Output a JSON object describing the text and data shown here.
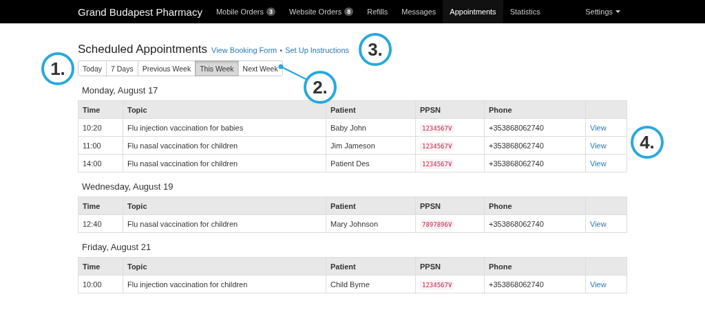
{
  "navbar": {
    "brand": "Grand Budapest Pharmacy",
    "items": [
      {
        "label": "Mobile Orders",
        "badge": "3",
        "selected": false
      },
      {
        "label": "Website Orders",
        "badge": "8",
        "selected": false
      },
      {
        "label": "Refills",
        "selected": false
      },
      {
        "label": "Messages",
        "selected": false
      },
      {
        "label": "Appointments",
        "selected": true
      },
      {
        "label": "Statistics",
        "selected": false
      }
    ],
    "settings": "Settings"
  },
  "title": "Scheduled Appointments",
  "links": [
    "View Booking Form",
    "Set Up Instructions"
  ],
  "separator": "•",
  "filters": [
    {
      "label": "Today",
      "selected": false
    },
    {
      "label": "7 Days",
      "selected": false
    },
    {
      "label": "Previous Week",
      "selected": false
    },
    {
      "label": "This Week",
      "selected": true
    },
    {
      "label": "Next Week",
      "selected": false
    }
  ],
  "days": [
    {
      "heading": "Monday, August 17",
      "columns": [
        "Time",
        "Topic",
        "Patient",
        "PPSN",
        "Phone"
      ],
      "rows": [
        {
          "time": "10:20",
          "topic": "Flu injection vaccination for babies",
          "patient": "Baby John",
          "ppsn": "1234567V",
          "phone": "+353868062740",
          "action": "View"
        },
        {
          "time": "11:00",
          "topic": "Flu nasal vaccination for children",
          "patient": "Jim Jameson",
          "ppsn": "1234567V",
          "phone": "+353868062740",
          "action": "View"
        },
        {
          "time": "14:00",
          "topic": "Flu nasal vaccination for children",
          "patient": "Patient Des",
          "ppsn": "1234567V",
          "phone": "+353868062740",
          "action": "View"
        }
      ]
    },
    {
      "heading": "Wednesday, August 19",
      "columns": [
        "Time",
        "Topic",
        "Patient",
        "PPSN",
        "Phone"
      ],
      "rows": [
        {
          "time": "12:40",
          "topic": "Flu nasal vaccination for children",
          "patient": "Mary Johnson",
          "ppsn": "7897896V",
          "phone": "+353868062740",
          "action": "View"
        }
      ]
    },
    {
      "heading": "Friday, August 21",
      "columns": [
        "Time",
        "Topic",
        "Patient",
        "PPSN",
        "Phone"
      ],
      "rows": [
        {
          "time": "10:00",
          "topic": "Flu injection vaccination for children",
          "patient": "Child Byrne",
          "ppsn": "1234567V",
          "phone": "+353868062740",
          "action": "View"
        }
      ]
    }
  ],
  "callouts": [
    "1.",
    "2.",
    "3.",
    "4."
  ]
}
